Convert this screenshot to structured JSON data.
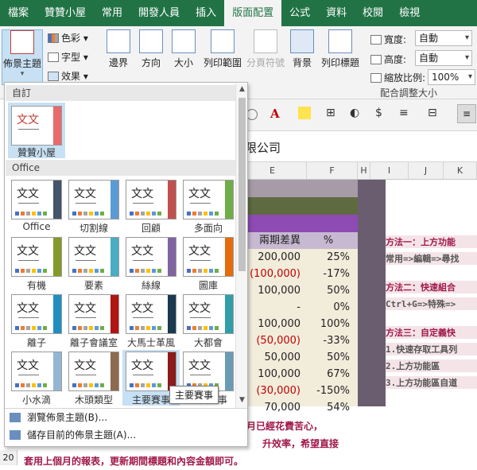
{
  "tabs": [
    {
      "label": "檔案"
    },
    {
      "label": "贊贊小屋"
    },
    {
      "label": "常用"
    },
    {
      "label": "開發人員"
    },
    {
      "label": "插入"
    },
    {
      "label": "版面配置"
    },
    {
      "label": "公式"
    },
    {
      "label": "資料"
    },
    {
      "label": "校閱"
    },
    {
      "label": "檢視"
    }
  ],
  "ribbon": {
    "themes_label": "佈景主題",
    "colors_label": "色彩",
    "fonts_label": "字型",
    "effects_label": "效果",
    "margins_label": "邊界",
    "orientation_label": "方向",
    "size_label": "大小",
    "print_area_label": "列印範圍",
    "breaks_label": "分頁符號",
    "background_label": "背景",
    "print_titles_label": "列印標題",
    "width_label": "寬度:",
    "height_label": "高度:",
    "scale_label": "縮放比例:",
    "width_value": "自動",
    "height_value": "自動",
    "scale_value": "100%",
    "group_label": "配合調整大小"
  },
  "gallery": {
    "custom_header": "自訂",
    "custom_theme": "贊贊小屋",
    "office_header": "Office",
    "themes": [
      {
        "name": "Office",
        "accent": "#44546a"
      },
      {
        "name": "切割線",
        "accent": "#5b9bd5"
      },
      {
        "name": "回顧",
        "accent": "#c0504d"
      },
      {
        "name": "多面向",
        "accent": "#70ad47"
      },
      {
        "name": "有機",
        "accent": "#83992a"
      },
      {
        "name": "要素",
        "accent": "#4bacc6"
      },
      {
        "name": "絲線",
        "accent": "#8064a2"
      },
      {
        "name": "圖庫",
        "accent": "#e46c0a"
      },
      {
        "name": "離子",
        "accent": "#1f8fbf"
      },
      {
        "name": "離子會議室",
        "accent": "#b01513"
      },
      {
        "name": "大馬士革風",
        "accent": "#1c3a4f"
      },
      {
        "name": "大都會",
        "accent": "#2e9fa8"
      },
      {
        "name": "小水滴",
        "accent": "#94b6d2"
      },
      {
        "name": "木頭類型",
        "accent": "#8c6b4f"
      },
      {
        "name": "主要賽事",
        "accent": "#8a1c1c"
      },
      {
        "name": "主要賽事",
        "accent": "#6a9bb5"
      }
    ],
    "browse_label": "瀏覽佈景主題(B)...",
    "save_label": "儲存目前的佈景主題(A)...",
    "tooltip": "主要賽事"
  },
  "sheet": {
    "formula_text": "限公司",
    "columns": [
      "E",
      "F",
      "H",
      "I",
      "J",
      "K"
    ],
    "header_diff": "兩期差異",
    "header_pct": "%",
    "rows": [
      {
        "v": "200,000",
        "p": "25%",
        "neg": false
      },
      {
        "v": "(100,000)",
        "p": "-17%",
        "neg": true
      },
      {
        "v": "100,000",
        "p": "50%",
        "neg": false
      },
      {
        "v": "-",
        "p": "0%",
        "neg": false
      },
      {
        "v": "100,000",
        "p": "100%",
        "neg": false
      },
      {
        "v": "(50,000)",
        "p": "-33%",
        "neg": true
      },
      {
        "v": "50,000",
        "p": "50%",
        "neg": false
      },
      {
        "v": "100,000",
        "p": "67%",
        "neg": false
      },
      {
        "v": "(30,000)",
        "p": "-150%",
        "neg": true
      },
      {
        "v": "70,000",
        "p": "54%",
        "neg": false
      }
    ],
    "tips": [
      "方法一：上方功能",
      "常用=>編輯=>尋找",
      "方法二：快速組合",
      "Ctrl+G=>特殊=>",
      "方法三：自定義快",
      "1.快速存取工具列",
      "2.上方功能區",
      "3.上方功能區自道"
    ],
    "message_lines": [
      "月已經花費苦心，",
      "升效率，希望直接",
      "套用上個月的報表，更新期間標題和內容金額即可。"
    ],
    "row_number": "20"
  }
}
